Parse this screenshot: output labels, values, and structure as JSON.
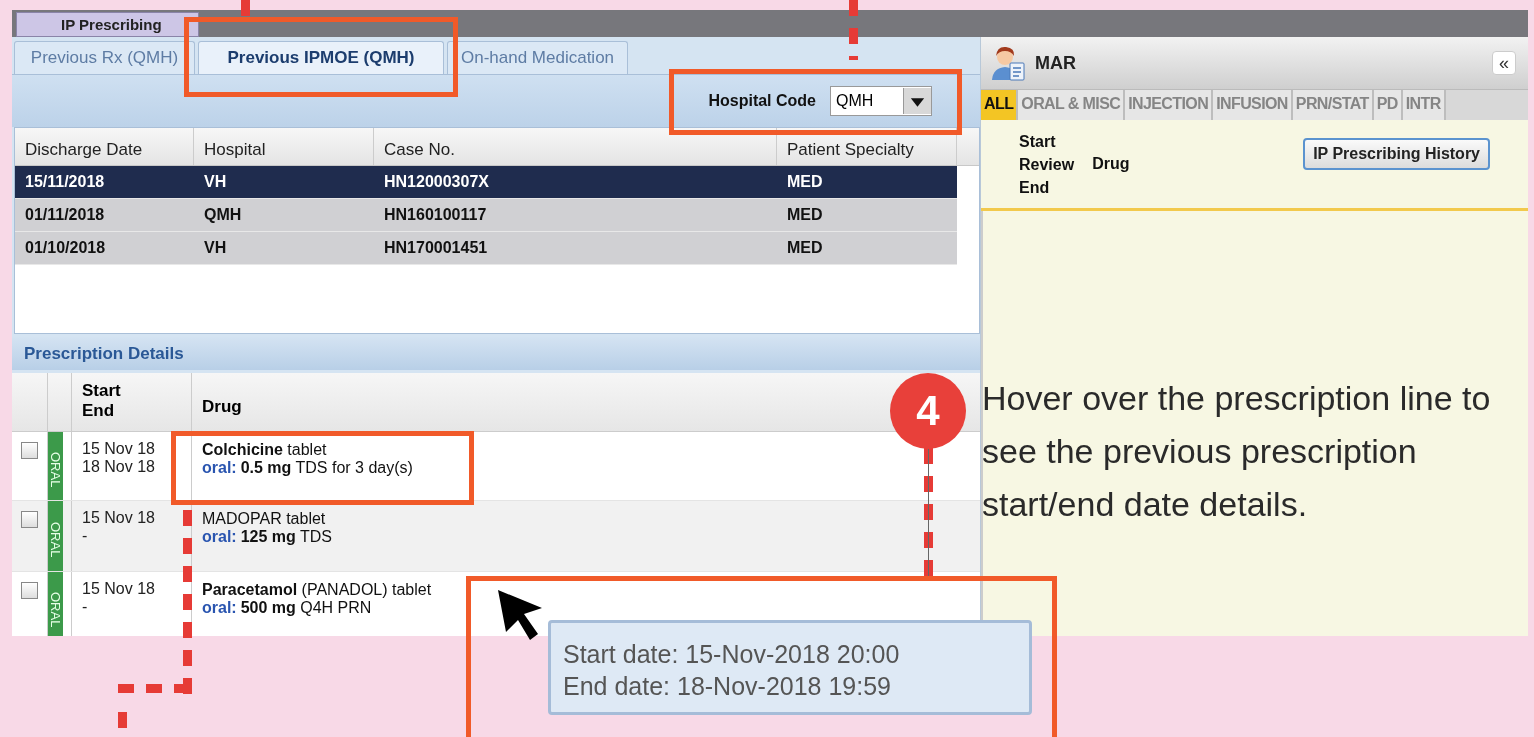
{
  "app_tab": {
    "label": "IP Prescribing",
    "selected": true
  },
  "tabs": [
    {
      "label": "Previous Rx (QMH)",
      "selected": false
    },
    {
      "label": "Previous IPMOE (QMH)",
      "selected": true
    },
    {
      "label": "On-hand Medication",
      "selected": false
    }
  ],
  "hospital_code": {
    "label": "Hospital Code",
    "value": "QMH"
  },
  "discharge_table": {
    "columns": [
      "Discharge Date",
      "Hospital",
      "Case No.",
      "Patient Specialty"
    ],
    "rows": [
      {
        "cells": [
          "15/11/2018",
          "VH",
          "HN12000307X",
          "MED"
        ],
        "selected": true
      },
      {
        "cells": [
          "01/11/2018",
          "QMH",
          "HN160100117",
          "MED"
        ],
        "selected": false
      },
      {
        "cells": [
          "01/10/2018",
          "VH",
          "HN170001451",
          "MED"
        ],
        "selected": false
      }
    ]
  },
  "prescription_details": {
    "title": "Prescription Details",
    "columns": {
      "start": "Start",
      "end": "End",
      "drug": "Drug"
    },
    "rows": [
      {
        "checked": false,
        "route_tag": "ORAL",
        "start": "15 Nov 18",
        "end": "18 Nov 18",
        "drug": "**Colchicine** tablet",
        "route": "oral:",
        "dose": "**0.5 mg** TDS for 3 day(s)"
      },
      {
        "checked": false,
        "route_tag": "ORAL",
        "start": "15 Nov 18",
        "end": "-",
        "drug": "MADOPAR tablet",
        "route": "oral:",
        "dose": "**125 mg** TDS"
      },
      {
        "checked": false,
        "route_tag": "ORAL",
        "start": "15 Nov 18",
        "end": "-",
        "drug": "**Paracetamol** (PANADOL) tablet",
        "route": "oral:",
        "dose": "**500 mg** Q4H PRN"
      }
    ]
  },
  "mar": {
    "title": "MAR",
    "collapse_button": "«",
    "filters": [
      {
        "label": "ALL",
        "selected": true
      },
      {
        "label": "ORAL & MISC",
        "selected": false
      },
      {
        "label": "INJECTION",
        "selected": false
      },
      {
        "label": "INFUSION",
        "selected": false
      },
      {
        "label": "PRN/STAT",
        "selected": false
      },
      {
        "label": "PD",
        "selected": false
      },
      {
        "label": "INTR",
        "selected": false
      }
    ],
    "header_lines": [
      "Start",
      "Review",
      "End"
    ],
    "drug_header": "Drug",
    "history_button": "IP Prescribing History"
  },
  "tooltip": {
    "lines": [
      "Start date: 15-Nov-2018 20:00",
      "End date: 18-Nov-2018 19:59"
    ]
  },
  "annotation": {
    "step": "4",
    "text": "Hover over the prescription line to see the previous prescription start/end date details."
  }
}
